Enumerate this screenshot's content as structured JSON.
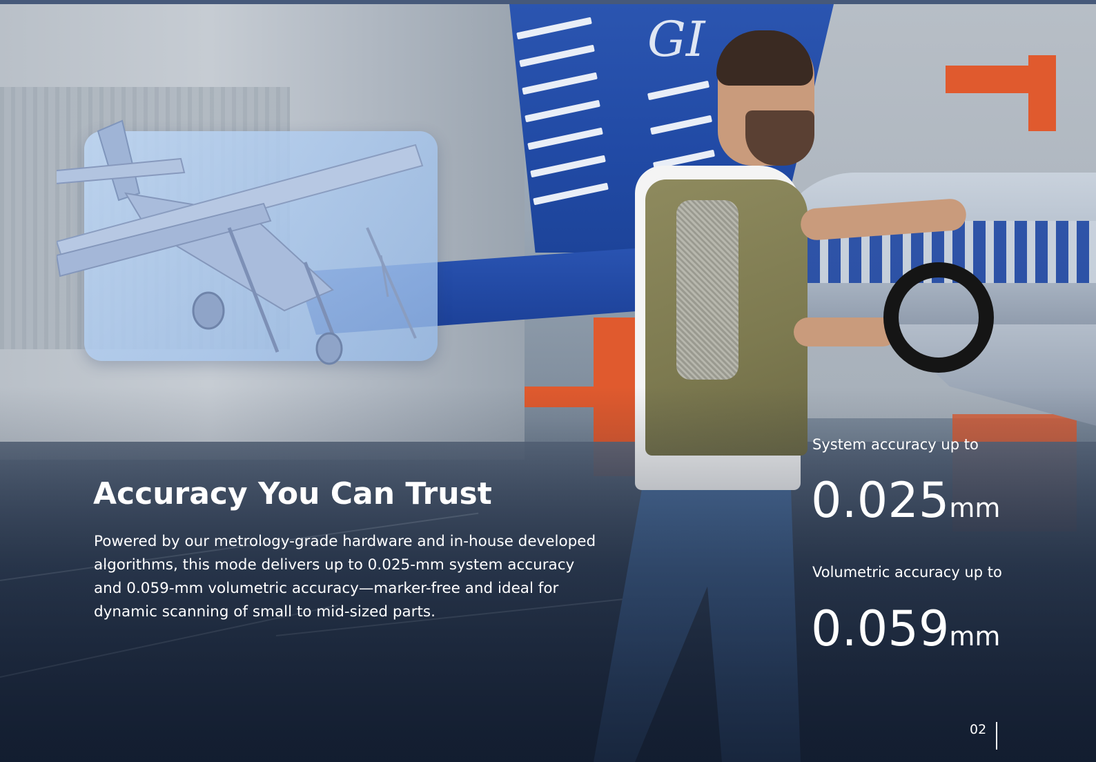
{
  "brochure": {
    "headline": "Accuracy You Can Trust",
    "body": "Powered by our metrology-grade hardware and in-house developed algorithms, this mode delivers up to 0.025-mm system accuracy and 0.059-mm volumetric accuracy—marker-free and ideal for dynamic scanning of small to mid-sized parts.",
    "tail_lettering": "GI"
  },
  "stats": [
    {
      "label": "System accuracy up to",
      "value": "0.025",
      "unit": "mm"
    },
    {
      "label": "Volumetric accuracy up to",
      "value": "0.059",
      "unit": "mm"
    }
  ],
  "footer": {
    "page_number": "02"
  },
  "colors": {
    "text": "#ffffff",
    "tail_blue": "#2450ad",
    "model_tint": "#a8c3ea",
    "vest": "#7d7a50",
    "rack_orange": "#e05a2e"
  }
}
